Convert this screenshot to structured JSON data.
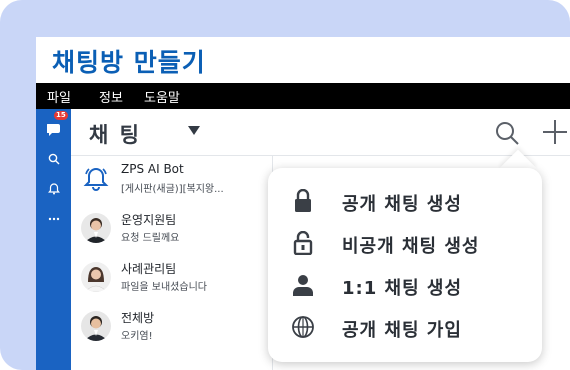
{
  "window": {
    "title": "채팅방 만들기"
  },
  "menu": {
    "items": [
      "파일",
      "정보",
      "도움말"
    ]
  },
  "sidebar": {
    "badge": "15",
    "icons": [
      "chat-icon",
      "search-icon",
      "bell-icon",
      "more-icon"
    ]
  },
  "list_header": {
    "title": "채 팅"
  },
  "chats": [
    {
      "name": "ZPS AI Bot",
      "preview": "[게시판(새글)][복지왕...",
      "avatar": "bell-icon"
    },
    {
      "name": "운영지원팀",
      "preview": "요청 드릴께요",
      "avatar": "person-photo"
    },
    {
      "name": "사례관리팀",
      "preview": "파일을 보내셨습니다",
      "avatar": "person-photo"
    },
    {
      "name": "전체방",
      "preview": "오키염!",
      "avatar": "person-photo"
    }
  ],
  "popup": {
    "items": [
      {
        "label": "공개 채팅 생성",
        "icon": "lock-icon"
      },
      {
        "label": "비공개 채팅 생성",
        "icon": "unlock-icon"
      },
      {
        "label": "1:1 채팅 생성",
        "icon": "person-icon"
      },
      {
        "label": "공개 채팅 가입",
        "icon": "globe-icon"
      }
    ]
  },
  "colors": {
    "accent": "#1a63c2",
    "title": "#0b5fb5",
    "background": "#c9d6f7"
  }
}
